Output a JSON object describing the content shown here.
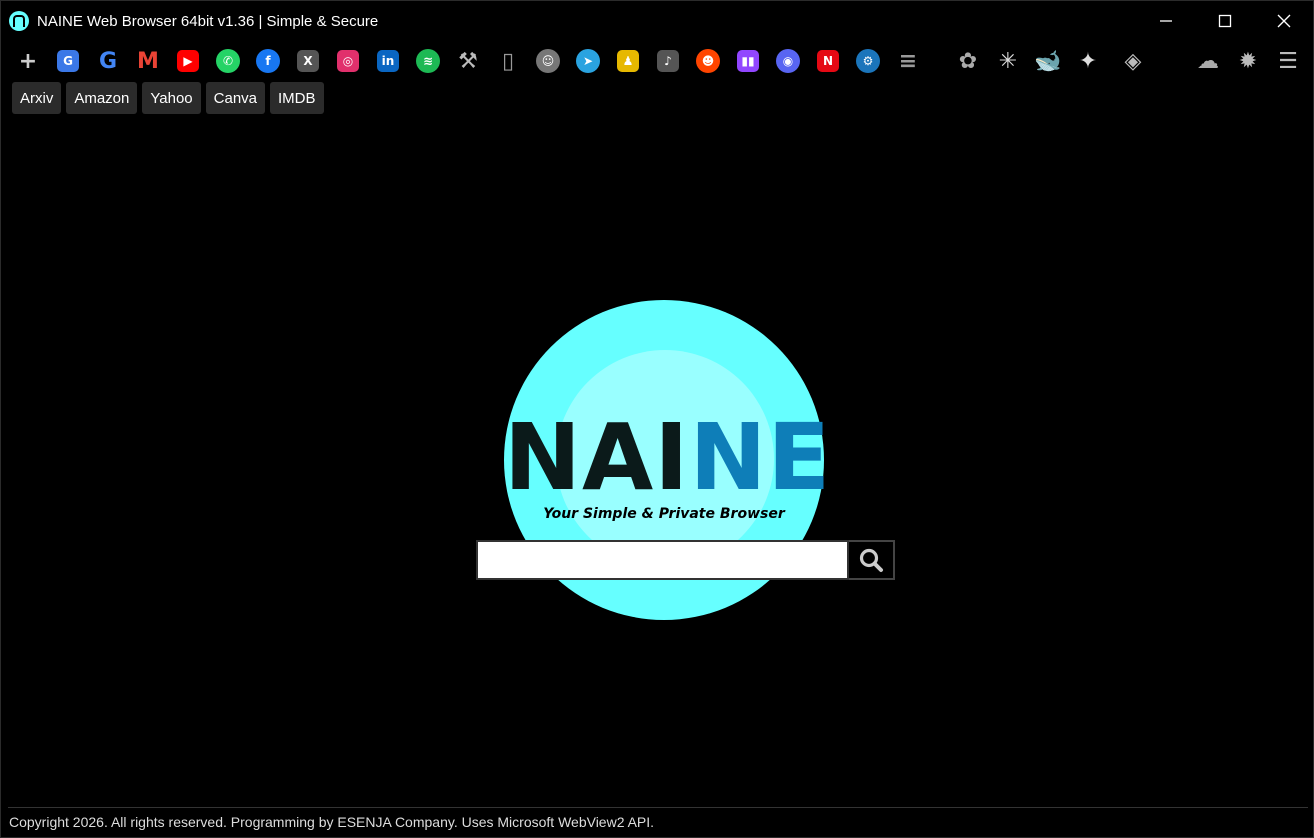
{
  "window": {
    "title": "NAINE Web Browser 64bit v1.36 | Simple & Secure",
    "controls": {
      "minimize": "minimize",
      "maximize": "maximize",
      "close": "close"
    }
  },
  "toolbar": {
    "icons": [
      {
        "name": "add-tab-icon",
        "glyph": "+",
        "color": "#cccccc"
      },
      {
        "name": "google-translate-icon",
        "glyph": "G",
        "color": "#3b78e7"
      },
      {
        "name": "google-icon",
        "glyph": "G",
        "color": "#4285f4"
      },
      {
        "name": "gmail-icon",
        "glyph": "M",
        "color": "#ea4335"
      },
      {
        "name": "youtube-icon",
        "glyph": "▶",
        "color": "#ff0000"
      },
      {
        "name": "whatsapp-icon",
        "glyph": "✆",
        "color": "#25d366"
      },
      {
        "name": "facebook-icon",
        "glyph": "f",
        "color": "#1877f2"
      },
      {
        "name": "x-twitter-icon",
        "glyph": "X",
        "color": "#555555"
      },
      {
        "name": "instagram-icon",
        "glyph": "◎",
        "color": "#e1306c"
      },
      {
        "name": "linkedin-icon",
        "glyph": "in",
        "color": "#0a66c2"
      },
      {
        "name": "spotify-icon",
        "glyph": "≋",
        "color": "#1db954"
      },
      {
        "name": "tools-hammer-icon",
        "glyph": "⚒",
        "color": "#bbbbbb"
      },
      {
        "name": "mobile-phone-icon",
        "glyph": "▯",
        "color": "#999999"
      },
      {
        "name": "github-icon",
        "glyph": "☺",
        "color": "#777777"
      },
      {
        "name": "telegram-icon",
        "glyph": "➤",
        "color": "#2aa3e0"
      },
      {
        "name": "snapchat-icon",
        "glyph": "♟",
        "color": "#e6b800"
      },
      {
        "name": "tiktok-icon",
        "glyph": "♪",
        "color": "#555555"
      },
      {
        "name": "reddit-icon",
        "glyph": "☻",
        "color": "#ff4500"
      },
      {
        "name": "twitch-icon",
        "glyph": "▮▮",
        "color": "#9146ff"
      },
      {
        "name": "discord-icon",
        "glyph": "◉",
        "color": "#5865f2"
      },
      {
        "name": "netflix-icon",
        "glyph": "N",
        "color": "#e50914"
      },
      {
        "name": "steam-icon",
        "glyph": "⚙",
        "color": "#1b75bb"
      },
      {
        "name": "proxy-server-icon",
        "glyph": "≡",
        "color": "#999999"
      },
      {
        "name": "chatgpt-icon",
        "glyph": "✿",
        "color": "#aaaaaa"
      },
      {
        "name": "claude-icon",
        "glyph": "✳",
        "color": "#dddddd"
      },
      {
        "name": "deepseek-icon",
        "glyph": "🐋",
        "color": "#aaaaaa"
      },
      {
        "name": "gemini-icon",
        "glyph": "✦",
        "color": "#dddddd"
      },
      {
        "name": "copilot-icon",
        "glyph": "◈",
        "color": "#bbbbbb"
      },
      {
        "name": "download-cloud-icon",
        "glyph": "☁",
        "color": "#aaaaaa"
      },
      {
        "name": "settings-gear-icon",
        "glyph": "✹",
        "color": "#bbbbbb"
      },
      {
        "name": "menu-hamburger-icon",
        "glyph": "☰",
        "color": "#bbbbbb"
      }
    ]
  },
  "bookmarks": [
    {
      "label": "Arxiv"
    },
    {
      "label": "Amazon"
    },
    {
      "label": "Yahoo"
    },
    {
      "label": "Canva"
    },
    {
      "label": "IMDB"
    }
  ],
  "logo": {
    "word_dark": "NAI",
    "word_blue": "NE",
    "tagline": "Your Simple & Private Browser"
  },
  "search": {
    "value": "",
    "placeholder": ""
  },
  "footer": {
    "text": "Copyright 2026. All rights reserved.  Programming by ESENJA Company. Uses Microsoft WebView2 API."
  }
}
